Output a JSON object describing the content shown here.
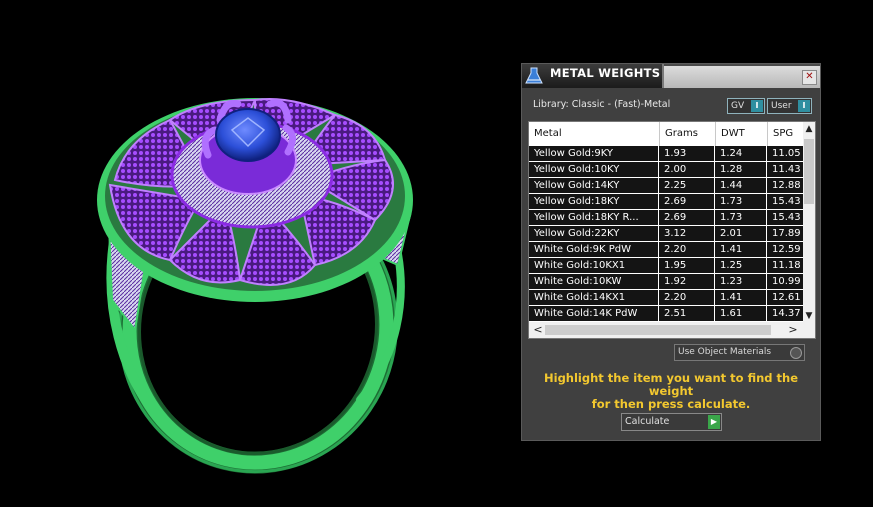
{
  "panel": {
    "title": "METAL WEIGHTS",
    "close_label": "✕",
    "library_label": "Library: Classic - (Fast)-Metal",
    "toggles": [
      {
        "label": "GV",
        "knob": "I"
      },
      {
        "label": "User",
        "knob": "I"
      }
    ],
    "columns": [
      "Metal",
      "Grams",
      "DWT",
      "SPG"
    ],
    "rows": [
      {
        "metal": "Yellow Gold:9KY",
        "grams": "1.93",
        "dwt": "1.24",
        "spg": "11.05"
      },
      {
        "metal": "Yellow Gold:10KY",
        "grams": "2.00",
        "dwt": "1.28",
        "spg": "11.43"
      },
      {
        "metal": "Yellow Gold:14KY",
        "grams": "2.25",
        "dwt": "1.44",
        "spg": "12.88"
      },
      {
        "metal": "Yellow Gold:18KY",
        "grams": "2.69",
        "dwt": "1.73",
        "spg": "15.43"
      },
      {
        "metal": "Yellow Gold:18KY R...",
        "grams": "2.69",
        "dwt": "1.73",
        "spg": "15.43"
      },
      {
        "metal": "Yellow Gold:22KY",
        "grams": "3.12",
        "dwt": "2.01",
        "spg": "17.89"
      },
      {
        "metal": "White Gold:9K PdW",
        "grams": "2.20",
        "dwt": "1.41",
        "spg": "12.59"
      },
      {
        "metal": "White Gold:10KX1",
        "grams": "1.95",
        "dwt": "1.25",
        "spg": "11.18"
      },
      {
        "metal": "White Gold:10KW",
        "grams": "1.92",
        "dwt": "1.23",
        "spg": "10.99"
      },
      {
        "metal": "White Gold:14KX1",
        "grams": "2.20",
        "dwt": "1.41",
        "spg": "12.61"
      },
      {
        "metal": "White Gold:14K PdW",
        "grams": "2.51",
        "dwt": "1.61",
        "spg": "14.37"
      }
    ],
    "scroll": {
      "up": "▲",
      "down": "▼",
      "left": "<",
      "right": ">"
    },
    "use_object_materials": "Use Object Materials",
    "hint_line1": "Highlight the item you want to find the weight",
    "hint_line2": "for then press calculate.",
    "calculate_label": "Calculate",
    "calculate_go": "▶"
  },
  "icons": {
    "title_icon": "flask-icon",
    "close": "close-icon"
  },
  "colors": {
    "hint_text": "#f3c82f",
    "toggle_knob": "#2f8fa0",
    "go_button": "#3aa64a",
    "ring_shank": "#3fd06a",
    "ring_head": "#8a2be2",
    "stone": "#2c4fd8"
  }
}
